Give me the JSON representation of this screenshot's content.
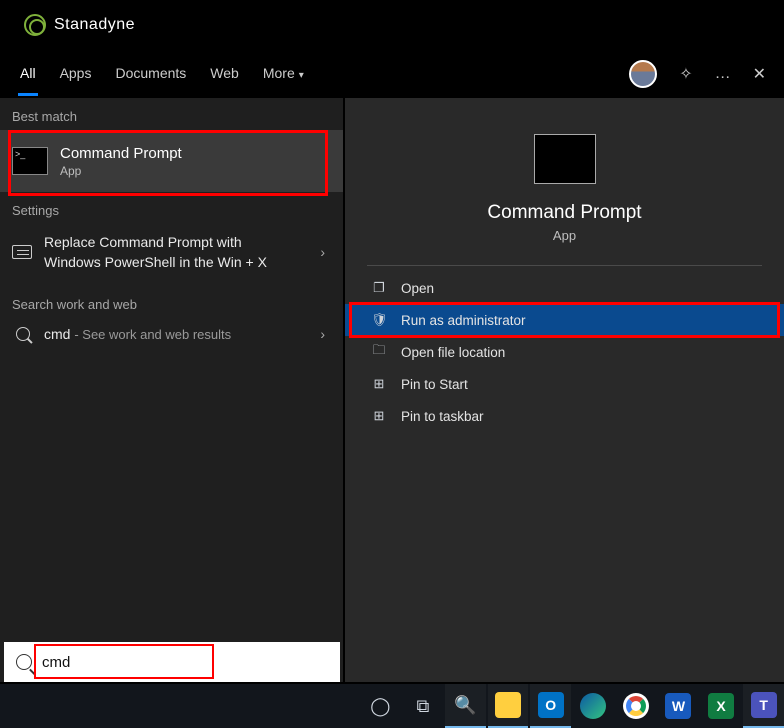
{
  "brand": "Stanadyne",
  "tabs": [
    "All",
    "Apps",
    "Documents",
    "Web",
    "More"
  ],
  "active_tab": "All",
  "left": {
    "best_label": "Best match",
    "best": {
      "title": "Command Prompt",
      "sub": "App"
    },
    "settings_label": "Settings",
    "settings_item": "Replace Command Prompt with Windows PowerShell in the Win + X",
    "web_label": "Search work and web",
    "web_query": "cmd",
    "web_hint": "- See work and web results"
  },
  "right": {
    "title": "Command Prompt",
    "sub": "App",
    "actions": [
      {
        "label": "Open",
        "icon": "❐"
      },
      {
        "label": "Run as administrator",
        "icon": "🛡"
      },
      {
        "label": "Open file location",
        "icon": "🗀"
      },
      {
        "label": "Pin to Start",
        "icon": "⊞"
      },
      {
        "label": "Pin to taskbar",
        "icon": "⊞"
      }
    ],
    "selected_index": 1
  },
  "search_value": "cmd"
}
